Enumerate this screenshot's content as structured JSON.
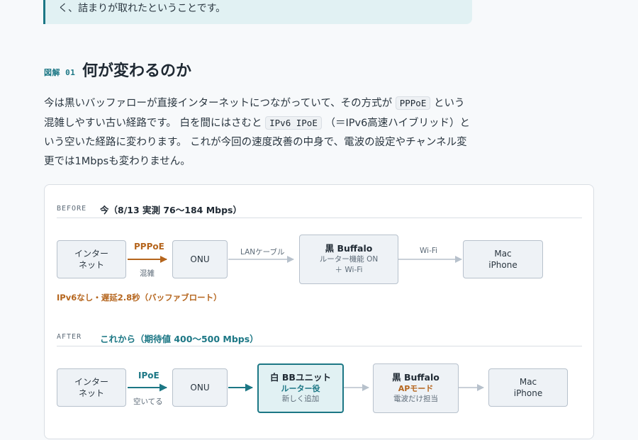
{
  "callout": {
    "text": "く、詰まりが取れたということです。"
  },
  "section": {
    "fig_label": "図解 01",
    "title": "何が変わるのか"
  },
  "paragraph": {
    "p1": "今は黒いバッファローが直接インターネットにつながっていて、その方式が",
    "code1": "PPPoE",
    "p2": "という混雑しやすい古い経路です。 白を間にはさむと",
    "code2": "IPv6 IPoE",
    "p3": "（＝IPv6高速ハイブリッド）という空いた経路に変わります。 これが今回の速度改善の中身で、電波の設定やチャンネル変更では1Mbpsも変わりません。"
  },
  "diagram": {
    "before": {
      "tag": "BEFORE",
      "title": "今（8/13 実測 76〜184 Mbps）",
      "nodes": {
        "internet": {
          "line1": "インター",
          "line2": "ネット"
        },
        "onu": {
          "label": "ONU"
        },
        "buffalo": {
          "main": "黒 Buffalo",
          "sub1": "ルーター機能 ON",
          "sub2": "＋ Wi-Fi"
        },
        "client": {
          "line1": "Mac",
          "line2": "iPhone"
        }
      },
      "edges": {
        "e1_top": "PPPoE",
        "e1_bottom": "混雑",
        "e2": "LANケーブル",
        "e3": "Wi-Fi"
      },
      "note": "IPv6なし・遅延2.8秒（バッファブロート）"
    },
    "after": {
      "tag": "AFTER",
      "title": "これから（期待値 400〜500 Mbps）",
      "nodes": {
        "internet": {
          "line1": "インター",
          "line2": "ネット"
        },
        "onu": {
          "label": "ONU"
        },
        "bb_unit": {
          "main": "白 BBユニット",
          "sub1": "ルーター役",
          "sub2": "新しく追加"
        },
        "buffalo": {
          "main": "黒 Buffalo",
          "sub1": "APモード",
          "sub2": "電波だけ担当"
        },
        "client": {
          "line1": "Mac",
          "line2": "iPhone"
        }
      },
      "edges": {
        "e1_top": "IPoE",
        "e1_bottom": "空いてる"
      }
    },
    "colors": {
      "teal": "#1c7785",
      "orange": "#b5651d",
      "gray_arrow": "#b7c1cc"
    }
  }
}
